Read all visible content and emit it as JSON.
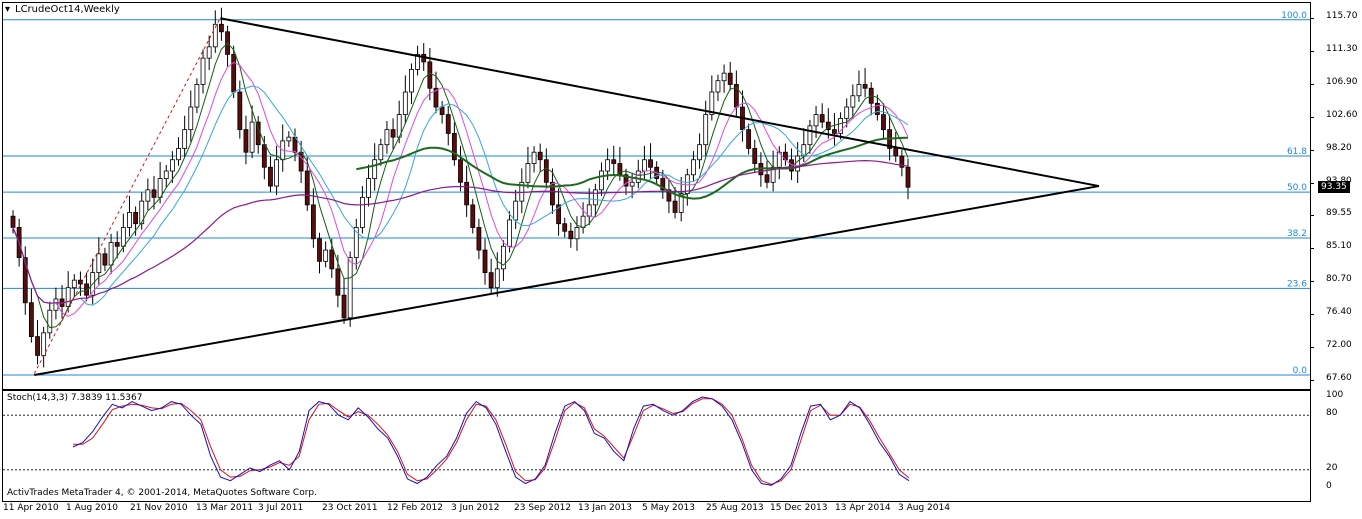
{
  "chart_title": "LCrudeOct14,Weekly",
  "current_price": "93.35",
  "indicator_label": "Stoch(14,3,3) 7.3839 11.5367",
  "copyright": "ActivTrades MetaTrader 4, © 2001-2014, MetaQuotes Software Corp.",
  "colors": {
    "background": "#ffffff",
    "fib_lines": "#1e8ad8",
    "fib_labels": "#1e8ad8",
    "trendlines": "#000000",
    "candle_bear": "#5b0c0c",
    "candle_bull": "#ffffff",
    "ma_long_purple": "#8b1a8b",
    "ma_green": "#1c6b1c",
    "ma_pink": "#e04ae0",
    "ma_skyblue": "#36a8d8",
    "ma_darkgreen_fast": "#165e16",
    "stoch_main": "#1010c8",
    "stoch_signal": "#e01010",
    "price_tag_bg": "#000000",
    "price_tag_fg": "#ffffff"
  },
  "fib_levels": [
    {
      "label": "100.0",
      "price": 115.6
    },
    {
      "label": "61.8",
      "price": 97.5
    },
    {
      "label": "50.0",
      "price": 92.7
    },
    {
      "label": "38.2",
      "price": 86.6
    },
    {
      "label": "23.6",
      "price": 79.9
    },
    {
      "label": "0.0",
      "price": 68.4
    }
  ],
  "price_axis_ticks": [
    "115.70",
    "111.30",
    "106.90",
    "102.60",
    "98.20",
    "93.80",
    "89.55",
    "85.10",
    "80.70",
    "76.40",
    "72.00",
    "67.60"
  ],
  "osc_axis_ticks": [
    "100",
    "80",
    "20",
    "0"
  ],
  "time_axis_ticks": [
    "11 Apr 2010",
    "1 Aug 2010",
    "21 Nov 2010",
    "13 Mar 2011",
    "3 Jul 2011",
    "23 Oct 2011",
    "12 Feb 2012",
    "3 Jun 2012",
    "23 Sep 2012",
    "13 Jan 2013",
    "5 May 2013",
    "25 Aug 2013",
    "15 Dec 2013",
    "13 Apr 2014",
    "3 Aug 2014"
  ],
  "chart_data": {
    "type": "candlestick",
    "symbol_timeframe": "LCrudeOct14,Weekly",
    "ylim": [
      67.6,
      115.7
    ],
    "weekly_closes_approx": [
      88.0,
      84.0,
      78.0,
      73.5,
      71.0,
      74.0,
      77.0,
      78.5,
      77.5,
      80.0,
      81.0,
      80.5,
      79.0,
      82.0,
      84.5,
      83.0,
      86.0,
      85.5,
      88.0,
      90.0,
      88.5,
      91.5,
      93.0,
      92.0,
      94.5,
      95.5,
      97.0,
      98.5,
      101.0,
      104.0,
      107.0,
      110.5,
      112.0,
      115.0,
      114.0,
      111.0,
      106.0,
      101.0,
      98.0,
      102.0,
      99.0,
      96.0,
      93.5,
      97.0,
      99.5,
      100.0,
      98.0,
      95.5,
      91.0,
      86.5,
      83.5,
      85.0,
      82.5,
      79.0,
      76.0,
      84.0,
      88.0,
      92.0,
      94.5,
      97.0,
      99.0,
      101.0,
      100.0,
      103.0,
      106.0,
      109.0,
      111.0,
      110.0,
      106.5,
      104.0,
      103.0,
      100.5,
      97.0,
      94.0,
      91.0,
      88.0,
      85.0,
      82.0,
      80.0,
      82.5,
      85.5,
      89.0,
      91.5,
      94.0,
      96.5,
      98.0,
      97.0,
      94.0,
      91.0,
      88.5,
      87.5,
      86.5,
      88.0,
      89.5,
      91.0,
      93.0,
      95.5,
      97.0,
      96.5,
      95.0,
      93.5,
      94.0,
      95.5,
      97.0,
      96.0,
      94.5,
      93.0,
      91.5,
      90.0,
      92.5,
      95.0,
      97.0,
      99.0,
      103.0,
      106.0,
      107.5,
      108.5,
      107.0,
      104.0,
      101.0,
      98.5,
      96.5,
      95.0,
      94.0,
      96.0,
      98.0,
      97.0,
      95.5,
      97.5,
      99.0,
      101.5,
      103.0,
      102.0,
      101.0,
      100.5,
      102.5,
      104.0,
      105.5,
      107.0,
      106.5,
      104.5,
      103.0,
      101.0,
      98.5,
      97.5,
      96.0,
      93.35
    ],
    "stochastic_main_approx": [
      45,
      50,
      62,
      78,
      92,
      88,
      95,
      90,
      85,
      88,
      95,
      92,
      80,
      70,
      35,
      12,
      8,
      15,
      22,
      18,
      25,
      30,
      20,
      40,
      85,
      95,
      92,
      80,
      75,
      88,
      78,
      65,
      55,
      35,
      10,
      5,
      12,
      25,
      35,
      55,
      82,
      95,
      88,
      70,
      40,
      12,
      5,
      10,
      25,
      60,
      90,
      95,
      85,
      60,
      55,
      40,
      30,
      65,
      90,
      92,
      85,
      80,
      85,
      95,
      100,
      98,
      90,
      75,
      50,
      20,
      5,
      3,
      10,
      25,
      60,
      90,
      92,
      75,
      80,
      95,
      88,
      70,
      50,
      35,
      15,
      8
    ],
    "stochastic_signal_approx": [
      48,
      48,
      55,
      70,
      86,
      90,
      92,
      91,
      88,
      87,
      92,
      93,
      85,
      75,
      45,
      20,
      12,
      13,
      19,
      20,
      23,
      28,
      25,
      35,
      75,
      92,
      93,
      85,
      78,
      84,
      80,
      70,
      58,
      40,
      15,
      8,
      10,
      20,
      32,
      50,
      75,
      92,
      90,
      75,
      48,
      18,
      8,
      9,
      22,
      52,
      85,
      94,
      88,
      65,
      57,
      45,
      33,
      58,
      85,
      91,
      87,
      82,
      84,
      93,
      98,
      98,
      92,
      80,
      55,
      25,
      8,
      4,
      8,
      20,
      52,
      85,
      91,
      80,
      80,
      92,
      89,
      74,
      55,
      38,
      20,
      11
    ],
    "levels": {
      "overbought": 80,
      "oversold": 20
    }
  }
}
